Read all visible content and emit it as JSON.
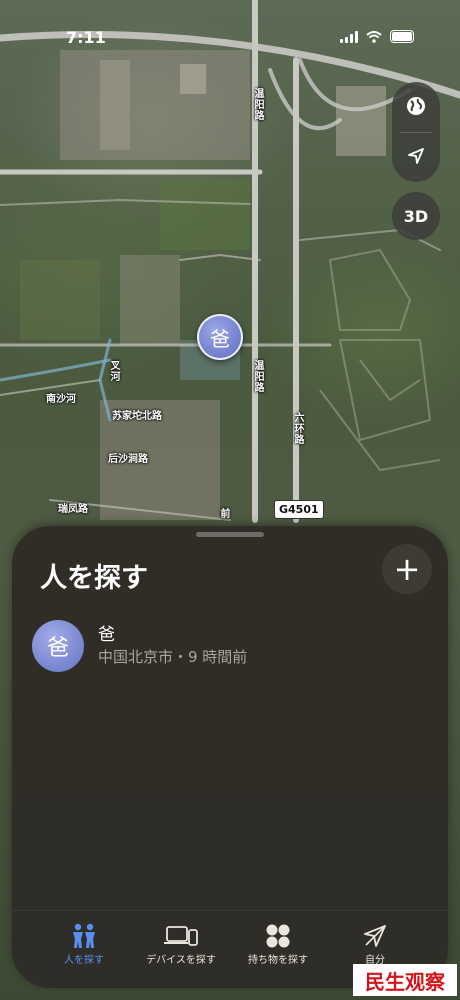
{
  "status_bar": {
    "time": "7:11"
  },
  "map": {
    "road_labels": {
      "wenyang_road_top": "温阳路",
      "wenyang_road_mid": "温阳路",
      "liuhuan_road": "六环路",
      "nanshahe": "南沙河",
      "chahe": "叉河",
      "suji_tuo_bei_road": "苏家坨北路",
      "houshajian_road": "后沙涧路",
      "ruifeng_road": "瑞凤路",
      "qian_fragment": "前"
    },
    "highway_shield": "G4501",
    "controls": {
      "btn_3d": "3D"
    },
    "pin_glyph": "爸"
  },
  "sheet": {
    "title": "人を探す",
    "add_symbol": "+",
    "people": [
      {
        "avatar_glyph": "爸",
        "name": "爸",
        "subtitle": "中国北京市・9 時間前"
      }
    ]
  },
  "tabbar": {
    "tabs": [
      {
        "label": "人を探す",
        "icon": "people-icon",
        "active": true
      },
      {
        "label": "デバイスを探す",
        "icon": "devices-icon",
        "active": false
      },
      {
        "label": "持ち物を探す",
        "icon": "items-icon",
        "active": false
      },
      {
        "label": "自分",
        "icon": "me-icon",
        "active": false
      }
    ],
    "active_color": "#5b8ef5"
  },
  "watermark": "民生观察"
}
